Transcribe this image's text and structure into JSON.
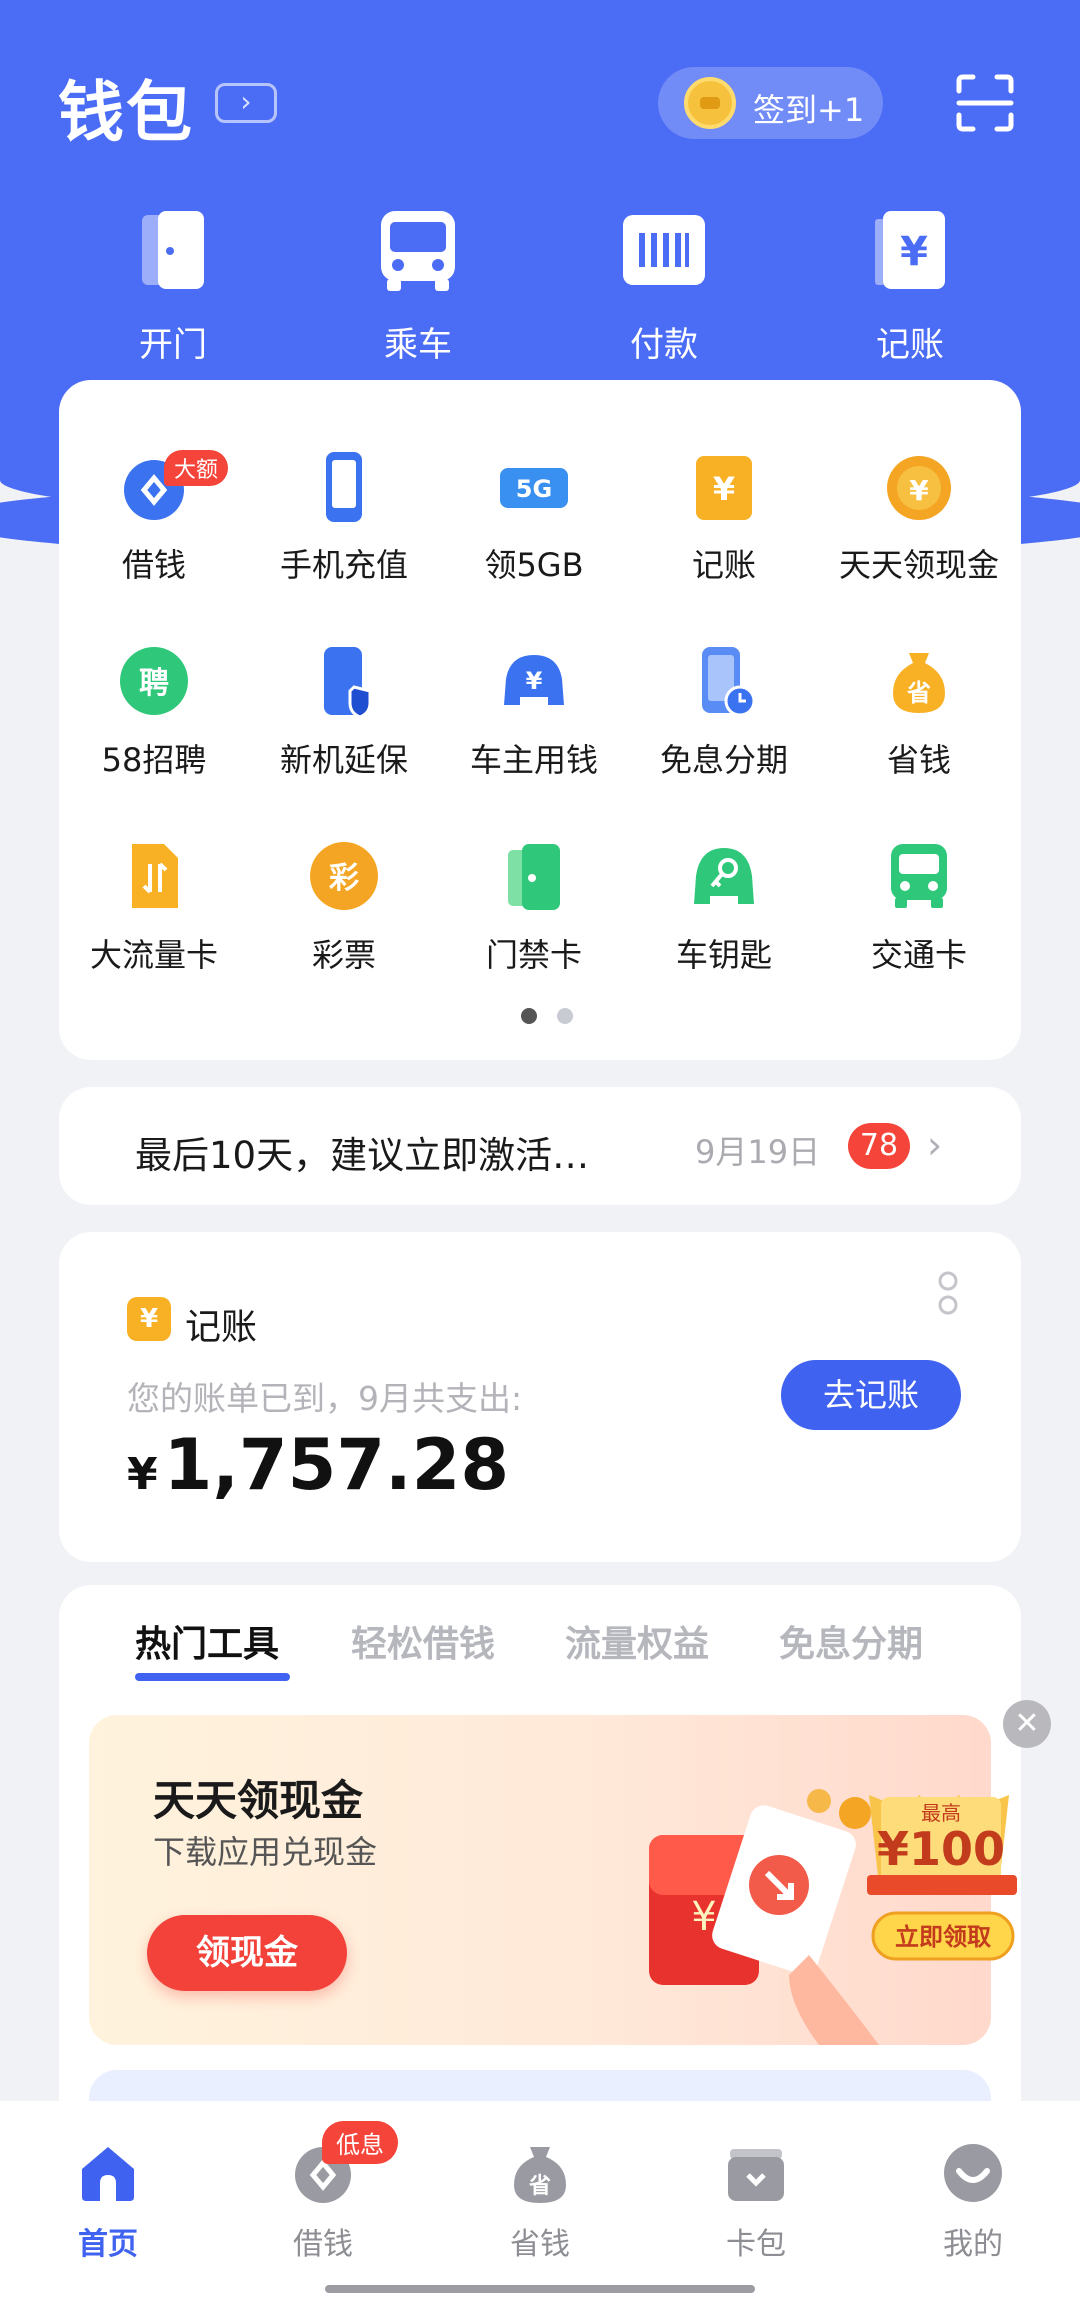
{
  "header": {
    "title": "钱包",
    "signin_label": "签到+1"
  },
  "quick_actions": [
    {
      "label": "开门",
      "icon": "door-icon"
    },
    {
      "label": "乘车",
      "icon": "bus-icon"
    },
    {
      "label": "付款",
      "icon": "barcode-icon"
    },
    {
      "label": "记账",
      "icon": "yuan-book-icon"
    }
  ],
  "services": [
    {
      "label": "借钱",
      "icon": "loan-icon",
      "badge": "大额"
    },
    {
      "label": "手机充值",
      "icon": "phone-icon"
    },
    {
      "label": "领5GB",
      "icon": "5g-icon"
    },
    {
      "label": "记账",
      "icon": "ledger-icon"
    },
    {
      "label": "天天领现金",
      "icon": "cash-coin-icon"
    },
    {
      "label": "58招聘",
      "icon": "recruit-icon"
    },
    {
      "label": "新机延保",
      "icon": "phone-shield-icon"
    },
    {
      "label": "车主用钱",
      "icon": "car-yuan-icon"
    },
    {
      "label": "免息分期",
      "icon": "phone-clock-icon"
    },
    {
      "label": "省钱",
      "icon": "money-bag-icon"
    },
    {
      "label": "大流量卡",
      "icon": "sim-card-icon"
    },
    {
      "label": "彩票",
      "icon": "lottery-icon"
    },
    {
      "label": "门禁卡",
      "icon": "access-card-icon"
    },
    {
      "label": "车钥匙",
      "icon": "car-key-icon"
    },
    {
      "label": "交通卡",
      "icon": "transit-card-icon"
    }
  ],
  "notice": {
    "text": "最后10天，建议立即激活…",
    "date": "9月19日",
    "count": "78"
  },
  "bill": {
    "title": "记账",
    "icon_char": "¥",
    "subtitle": "您的账单已到，9月共支出:",
    "currency": "¥",
    "amount": "1,757.28",
    "button": "去记账"
  },
  "tools": {
    "tabs": [
      "热门工具",
      "轻松借钱",
      "流量权益",
      "免息分期"
    ],
    "promo": {
      "title": "天天领现金",
      "subtitle": "下载应用兑现金",
      "button": "领现金",
      "art_top": "最高",
      "art_amount": "¥100",
      "art_button": "立即领取"
    }
  },
  "tabbar": [
    {
      "label": "首页",
      "icon": "home-icon",
      "active": true
    },
    {
      "label": "借钱",
      "icon": "loan-icon",
      "badge": "低息"
    },
    {
      "label": "省钱",
      "icon": "money-bag-icon"
    },
    {
      "label": "卡包",
      "icon": "card-wallet-icon"
    },
    {
      "label": "我的",
      "icon": "profile-icon"
    }
  ],
  "colors": {
    "primary": "#3f63f0",
    "header": "#4b6cf5",
    "badge": "#f5453a",
    "accent_orange": "#f8b125"
  }
}
